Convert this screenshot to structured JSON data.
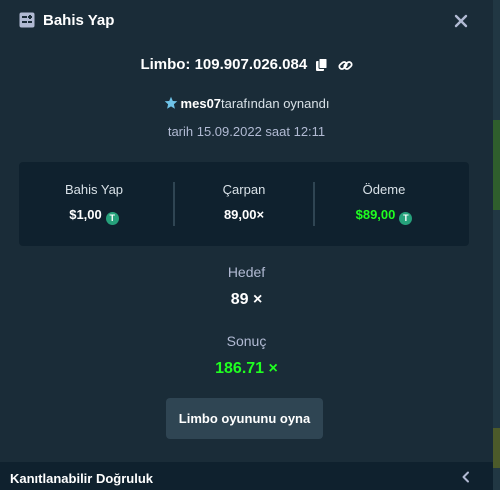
{
  "header": {
    "title": "Bahis Yap",
    "title_icon": "bet-slip-icon",
    "close_icon": "close-icon"
  },
  "bet": {
    "game_id": "Limbo: 109.907.026.084",
    "player": "mes07",
    "played_by_suffix": "tarafından oynandı",
    "date_text": "tarih 15.09.2022 saat 12:11"
  },
  "stats": {
    "bet_label": "Bahis Yap",
    "bet_value": "$1,00",
    "multiplier_label": "Çarpan",
    "multiplier_value": "89,00×",
    "payout_label": "Ödeme",
    "payout_value": "$89,00",
    "coin_symbol": "T"
  },
  "target": {
    "label": "Hedef",
    "value": "89 ×"
  },
  "result": {
    "label": "Sonuç",
    "value": "186.71 ×"
  },
  "play_button": "Limbo oyununu oyna",
  "footer": {
    "label": "Kanıtlanabilir Doğruluk"
  },
  "colors": {
    "background": "#1a2c38",
    "panel": "#0f212e",
    "green": "#1fff20",
    "button": "#2f4553",
    "muted_text": "#b1bad3",
    "coin": "#26a17b"
  }
}
